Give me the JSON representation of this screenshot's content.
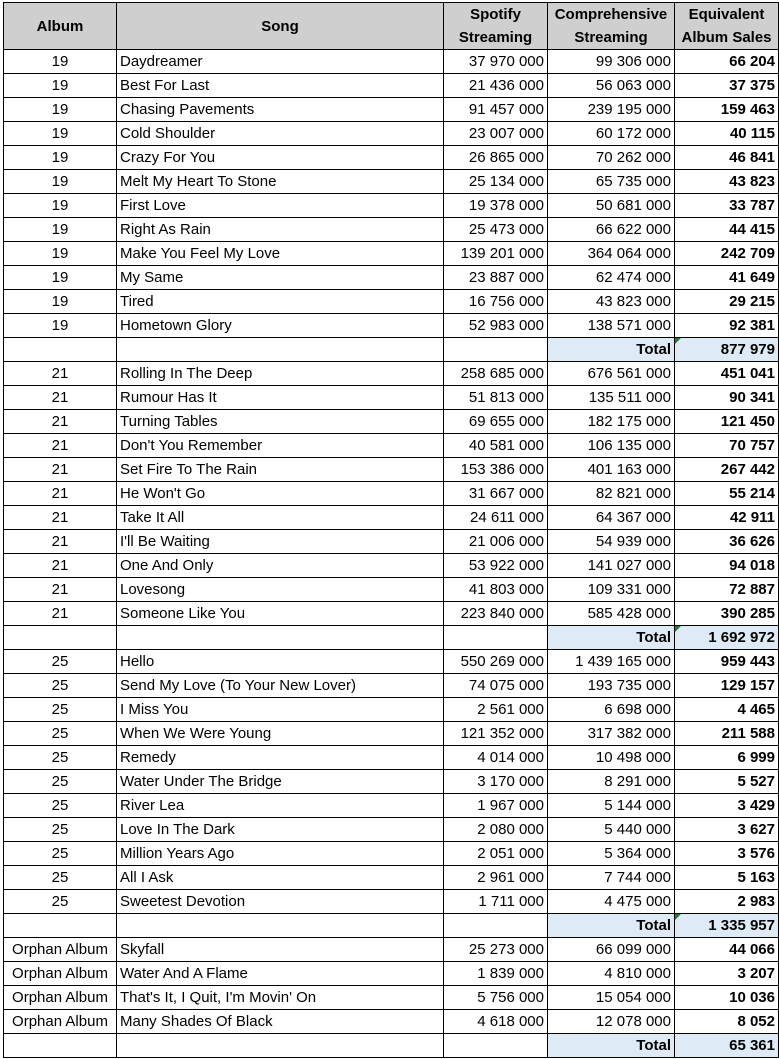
{
  "headers": {
    "album": "Album",
    "song": "Song",
    "spotify": [
      "Spotify",
      "Streaming"
    ],
    "comprehensive": [
      "Comprehensive",
      "Streaming"
    ],
    "equivalent": [
      "Equivalent",
      "Album Sales"
    ]
  },
  "total_label": "Total",
  "colors": {
    "header_bg": "#cfcfcf",
    "total_bg": "#deebf7",
    "corner_mark": "#1e7b34"
  },
  "groups": [
    {
      "rows": [
        {
          "album": "19",
          "song": "Daydreamer",
          "spotify": "37 970 000",
          "comprehensive": "99 306 000",
          "equivalent": "66 204"
        },
        {
          "album": "19",
          "song": "Best For Last",
          "spotify": "21 436 000",
          "comprehensive": "56 063 000",
          "equivalent": "37 375"
        },
        {
          "album": "19",
          "song": "Chasing Pavements",
          "spotify": "91 457 000",
          "comprehensive": "239 195 000",
          "equivalent": "159 463"
        },
        {
          "album": "19",
          "song": "Cold Shoulder",
          "spotify": "23 007 000",
          "comprehensive": "60 172 000",
          "equivalent": "40 115"
        },
        {
          "album": "19",
          "song": "Crazy For You",
          "spotify": "26 865 000",
          "comprehensive": "70 262 000",
          "equivalent": "46 841"
        },
        {
          "album": "19",
          "song": "Melt My Heart To Stone",
          "spotify": "25 134 000",
          "comprehensive": "65 735 000",
          "equivalent": "43 823"
        },
        {
          "album": "19",
          "song": "First Love",
          "spotify": "19 378 000",
          "comprehensive": "50 681 000",
          "equivalent": "33 787"
        },
        {
          "album": "19",
          "song": "Right As Rain",
          "spotify": "25 473 000",
          "comprehensive": "66 622 000",
          "equivalent": "44 415"
        },
        {
          "album": "19",
          "song": "Make You Feel My Love",
          "spotify": "139 201 000",
          "comprehensive": "364 064 000",
          "equivalent": "242 709"
        },
        {
          "album": "19",
          "song": "My Same",
          "spotify": "23 887 000",
          "comprehensive": "62 474 000",
          "equivalent": "41 649"
        },
        {
          "album": "19",
          "song": "Tired",
          "spotify": "16 756 000",
          "comprehensive": "43 823 000",
          "equivalent": "29 215"
        },
        {
          "album": "19",
          "song": "Hometown Glory",
          "spotify": "52 983 000",
          "comprehensive": "138 571 000",
          "equivalent": "92 381"
        }
      ],
      "total": "877 979",
      "marker": true
    },
    {
      "rows": [
        {
          "album": "21",
          "song": "Rolling In The Deep",
          "spotify": "258 685 000",
          "comprehensive": "676 561 000",
          "equivalent": "451 041"
        },
        {
          "album": "21",
          "song": "Rumour Has It",
          "spotify": "51 813 000",
          "comprehensive": "135 511 000",
          "equivalent": "90 341"
        },
        {
          "album": "21",
          "song": "Turning Tables",
          "spotify": "69 655 000",
          "comprehensive": "182 175 000",
          "equivalent": "121 450"
        },
        {
          "album": "21",
          "song": "Don't You Remember",
          "spotify": "40 581 000",
          "comprehensive": "106 135 000",
          "equivalent": "70 757"
        },
        {
          "album": "21",
          "song": "Set Fire To The Rain",
          "spotify": "153 386 000",
          "comprehensive": "401 163 000",
          "equivalent": "267 442"
        },
        {
          "album": "21",
          "song": "He Won't Go",
          "spotify": "31 667 000",
          "comprehensive": "82 821 000",
          "equivalent": "55 214"
        },
        {
          "album": "21",
          "song": "Take It All",
          "spotify": "24 611 000",
          "comprehensive": "64 367 000",
          "equivalent": "42 911"
        },
        {
          "album": "21",
          "song": "I'll Be Waiting",
          "spotify": "21 006 000",
          "comprehensive": "54 939 000",
          "equivalent": "36 626"
        },
        {
          "album": "21",
          "song": "One And Only",
          "spotify": "53 922 000",
          "comprehensive": "141 027 000",
          "equivalent": "94 018"
        },
        {
          "album": "21",
          "song": "Lovesong",
          "spotify": "41 803 000",
          "comprehensive": "109 331 000",
          "equivalent": "72 887"
        },
        {
          "album": "21",
          "song": "Someone Like You",
          "spotify": "223 840 000",
          "comprehensive": "585 428 000",
          "equivalent": "390 285"
        }
      ],
      "total": "1 692 972",
      "marker": true
    },
    {
      "rows": [
        {
          "album": "25",
          "song": "Hello",
          "spotify": "550 269 000",
          "comprehensive": "1 439 165 000",
          "equivalent": "959 443"
        },
        {
          "album": "25",
          "song": "Send My Love (To Your New Lover)",
          "spotify": "74 075 000",
          "comprehensive": "193 735 000",
          "equivalent": "129 157"
        },
        {
          "album": "25",
          "song": "I Miss You",
          "spotify": "2 561 000",
          "comprehensive": "6 698 000",
          "equivalent": "4 465"
        },
        {
          "album": "25",
          "song": "When We Were Young",
          "spotify": "121 352 000",
          "comprehensive": "317 382 000",
          "equivalent": "211 588"
        },
        {
          "album": "25",
          "song": "Remedy",
          "spotify": "4 014 000",
          "comprehensive": "10 498 000",
          "equivalent": "6 999"
        },
        {
          "album": "25",
          "song": "Water Under The Bridge",
          "spotify": "3 170 000",
          "comprehensive": "8 291 000",
          "equivalent": "5 527"
        },
        {
          "album": "25",
          "song": "River Lea",
          "spotify": "1 967 000",
          "comprehensive": "5 144 000",
          "equivalent": "3 429"
        },
        {
          "album": "25",
          "song": "Love In The Dark",
          "spotify": "2 080 000",
          "comprehensive": "5 440 000",
          "equivalent": "3 627"
        },
        {
          "album": "25",
          "song": "Million Years Ago",
          "spotify": "2 051 000",
          "comprehensive": "5 364 000",
          "equivalent": "3 576"
        },
        {
          "album": "25",
          "song": "All I Ask",
          "spotify": "2 961 000",
          "comprehensive": "7 744 000",
          "equivalent": "5 163"
        },
        {
          "album": "25",
          "song": "Sweetest Devotion",
          "spotify": "1 711 000",
          "comprehensive": "4 475 000",
          "equivalent": "2 983"
        }
      ],
      "total": "1 335 957",
      "marker": true
    },
    {
      "rows": [
        {
          "album": "Orphan Album",
          "song": "Skyfall",
          "spotify": "25 273 000",
          "comprehensive": "66 099 000",
          "equivalent": "44 066"
        },
        {
          "album": "Orphan Album",
          "song": "Water And A Flame",
          "spotify": "1 839 000",
          "comprehensive": "4 810 000",
          "equivalent": "3 207"
        },
        {
          "album": "Orphan Album",
          "song": "That's It, I Quit, I'm Movin' On",
          "spotify": "5 756 000",
          "comprehensive": "15 054 000",
          "equivalent": "10 036"
        },
        {
          "album": "Orphan Album",
          "song": "Many Shades Of Black",
          "spotify": "4 618 000",
          "comprehensive": "12 078 000",
          "equivalent": "8 052"
        }
      ],
      "total": "65 361",
      "marker": false
    }
  ]
}
